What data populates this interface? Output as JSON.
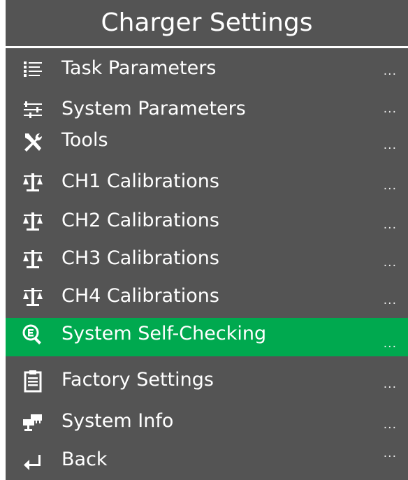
{
  "title": "Charger Settings",
  "colors": {
    "background": "#545454",
    "text": "#ffffff",
    "selected": "#00a94f"
  },
  "menu": {
    "items": [
      {
        "label": "Task Parameters",
        "icon": "list-icon",
        "more": "...",
        "selected": false
      },
      {
        "label": "System Parameters",
        "icon": "sliders-icon",
        "more": "...",
        "selected": false
      },
      {
        "label": "Tools",
        "icon": "tools-icon",
        "more": "...",
        "selected": false
      },
      {
        "label": "CH1 Calibrations",
        "icon": "scale-icon",
        "more": "...",
        "selected": false
      },
      {
        "label": "CH2 Calibrations",
        "icon": "scale-icon",
        "more": "...",
        "selected": false
      },
      {
        "label": "CH3 Calibrations",
        "icon": "scale-icon",
        "more": "...",
        "selected": false
      },
      {
        "label": "CH4 Calibrations",
        "icon": "scale-icon",
        "more": "...",
        "selected": false
      },
      {
        "label": "System Self-Checking",
        "icon": "search-check-icon",
        "more": "...",
        "selected": true
      },
      {
        "label": "Factory Settings",
        "icon": "clipboard-icon",
        "more": "...",
        "selected": false
      },
      {
        "label": "System Info",
        "icon": "network-icon",
        "more": "...",
        "selected": false
      },
      {
        "label": "Back",
        "icon": "back-arrow-icon",
        "more": "...",
        "selected": false
      }
    ]
  }
}
